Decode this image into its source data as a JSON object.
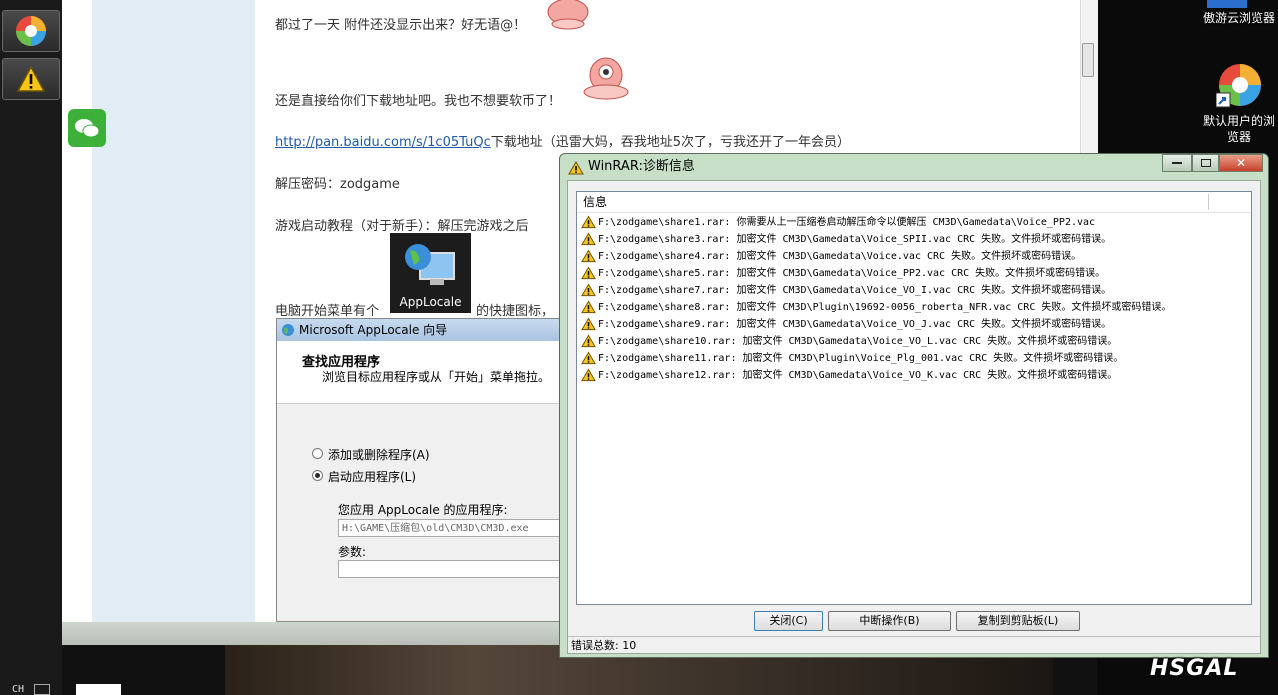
{
  "taskbar": {
    "lang": "CH"
  },
  "desktop": {
    "icon1_label": "傲游云浏览器",
    "icon2_label_line1": "默认用户的浏",
    "icon2_label_line2": "览器"
  },
  "post": {
    "line1": "都过了一天 附件还没显示出来？好无语@！",
    "line2": "还是直接给你们下载地址吧。我也不想要软币了！",
    "link": "http://pan.baidu.com/s/1c05TuQc",
    "link_suffix": "下载地址（迅雷大妈，吞我地址5次了，亏我还开了一年会员）",
    "password": "解压密码：zodgame",
    "tutorial": "游戏启动教程（对于新手）：解压完游戏之后",
    "start_menu_prefix": "电脑开始菜单有个",
    "start_menu_suffix": "的快捷图标，",
    "applocale_icon_label": "AppLocale"
  },
  "applocale_dialog": {
    "title": "Microsoft AppLocale 向导",
    "heading": "查找应用程序",
    "subheading": "浏览目标应用程序或从「开始」菜单拖拉。",
    "radio_add_remove": "添加或删除程序(A)",
    "radio_launch": "启动应用程序(L)",
    "app_label": "您应用 AppLocale 的应用程序:",
    "app_path": "H:\\GAME\\压缩包\\old\\CM3D\\CM3D.exe",
    "params_label": "参数:"
  },
  "winrar": {
    "title": "WinRAR:诊断信息",
    "column_header": "信息",
    "messages": [
      "F:\\zodgame\\share1.rar: 你需要从上一压缩卷启动解压命令以便解压 CM3D\\Gamedata\\Voice_PP2.vac",
      "F:\\zodgame\\share3.rar: 加密文件 CM3D\\Gamedata\\Voice_SPII.vac CRC 失败。文件损坏或密码错误。",
      "F:\\zodgame\\share4.rar: 加密文件 CM3D\\Gamedata\\Voice.vac CRC 失败。文件损坏或密码错误。",
      "F:\\zodgame\\share5.rar: 加密文件 CM3D\\Gamedata\\Voice_PP2.vac CRC 失败。文件损坏或密码错误。",
      "F:\\zodgame\\share7.rar: 加密文件 CM3D\\Gamedata\\Voice_VO_I.vac CRC 失败。文件损坏或密码错误。",
      "F:\\zodgame\\share8.rar: 加密文件 CM3D\\Plugin\\19692-0056_roberta_NFR.vac CRC 失败。文件损坏或密码错误。",
      "F:\\zodgame\\share9.rar: 加密文件 CM3D\\Gamedata\\Voice_VO_J.vac CRC 失败。文件损坏或密码错误。",
      "F:\\zodgame\\share10.rar: 加密文件 CM3D\\Gamedata\\Voice_VO_L.vac CRC 失败。文件损坏或密码错误。",
      "F:\\zodgame\\share11.rar: 加密文件 CM3D\\Plugin\\Voice_Plg_001.vac CRC 失败。文件损坏或密码错误。",
      "F:\\zodgame\\share12.rar: 加密文件 CM3D\\Gamedata\\Voice_VO_K.vac CRC 失败。文件损坏或密码错误。"
    ],
    "btn_close": "关闭(C)",
    "btn_abort": "中断操作(B)",
    "btn_copy": "复制到剪贴板(L)",
    "status": "错误总数: 10",
    "close_glyph": "✕"
  },
  "watermark": "HSGAL"
}
